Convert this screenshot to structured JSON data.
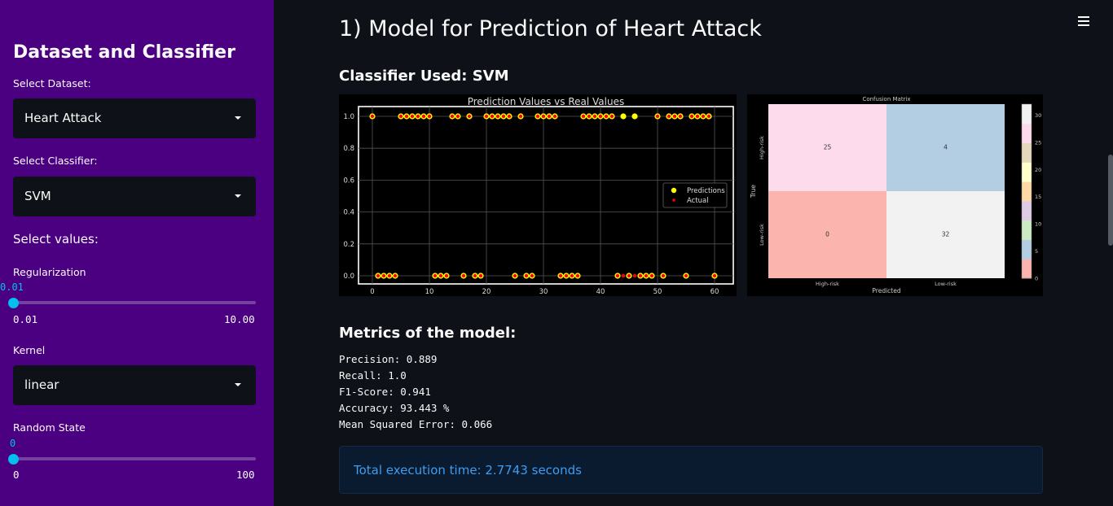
{
  "sidebar": {
    "title": "Dataset and Classifier",
    "dataset_label": "Select Dataset:",
    "dataset_value": "Heart Attack",
    "classifier_label": "Select Classifier:",
    "classifier_value": "SVM",
    "values_section": "Select values:",
    "regularization": {
      "label": "Regularization",
      "value": "0.01",
      "min": "0.01",
      "max": "10.00",
      "fraction": 0
    },
    "kernel": {
      "label": "Kernel",
      "value": "linear"
    },
    "random_state": {
      "label": "Random State",
      "value": "0",
      "min": "0",
      "max": "100",
      "fraction": 0
    }
  },
  "main": {
    "title": "1) Model for Prediction of Heart Attack",
    "classifier_heading": "Classifier Used: SVM",
    "metrics_heading": "Metrics of the model:",
    "metrics": [
      "Precision: 0.889",
      "Recall: 1.0",
      "F1-Score: 0.941",
      "Accuracy: 93.443 %",
      "Mean Squared Error: 0.066"
    ],
    "execution_time": "Total execution time: 2.7743 seconds"
  },
  "colors": {
    "sidebar_bg": "#4b0082",
    "main_bg": "#0e1117",
    "accent": "#00c0f2",
    "info_text": "#3d9df3"
  },
  "chart_data": [
    {
      "type": "scatter",
      "title": "Prediction Values vs Real Values",
      "xlim": [
        0,
        60
      ],
      "ylim": [
        0,
        1
      ],
      "x_ticks": [
        "0",
        "10",
        "20",
        "30",
        "40",
        "50",
        "60"
      ],
      "y_ticks": [
        "0.0",
        "0.2",
        "0.4",
        "0.6",
        "0.8",
        "1.0"
      ],
      "grid": true,
      "legend_position": "right",
      "series": [
        {
          "name": "Predictions",
          "color": "#ffff00",
          "values": [
            1,
            0,
            0,
            0,
            0,
            1,
            1,
            1,
            1,
            1,
            1,
            0,
            0,
            0,
            1,
            1,
            0,
            1,
            0,
            0,
            1,
            1,
            1,
            1,
            1,
            0,
            1,
            0,
            0,
            1,
            1,
            1,
            1,
            0,
            0,
            0,
            0,
            1,
            1,
            1,
            1,
            1,
            1,
            0,
            1,
            0,
            1,
            0,
            0,
            0,
            1,
            0,
            1,
            1,
            1,
            0,
            1,
            1,
            1,
            1,
            0
          ]
        },
        {
          "name": "Actual",
          "color": "#ff0000",
          "values": [
            1,
            0,
            0,
            0,
            0,
            1,
            1,
            1,
            1,
            1,
            1,
            0,
            0,
            0,
            1,
            1,
            0,
            1,
            0,
            0,
            1,
            1,
            1,
            1,
            1,
            0,
            1,
            0,
            0,
            1,
            1,
            1,
            1,
            0,
            0,
            0,
            0,
            1,
            1,
            1,
            1,
            1,
            1,
            0,
            0,
            0,
            0,
            0,
            0,
            0,
            1,
            0,
            1,
            1,
            1,
            0,
            1,
            1,
            1,
            1,
            0
          ]
        }
      ]
    },
    {
      "type": "heatmap",
      "title": "Confusion Matrix",
      "xlabel": "Predicted",
      "ylabel": "True",
      "categories": [
        "High-risk",
        "Low-risk"
      ],
      "values": [
        [
          25,
          4
        ],
        [
          0,
          32
        ]
      ],
      "colorbar_ticks": [
        "0",
        "5",
        "10",
        "15",
        "20",
        "25",
        "30"
      ],
      "colorbar_range": [
        0,
        32
      ]
    }
  ]
}
